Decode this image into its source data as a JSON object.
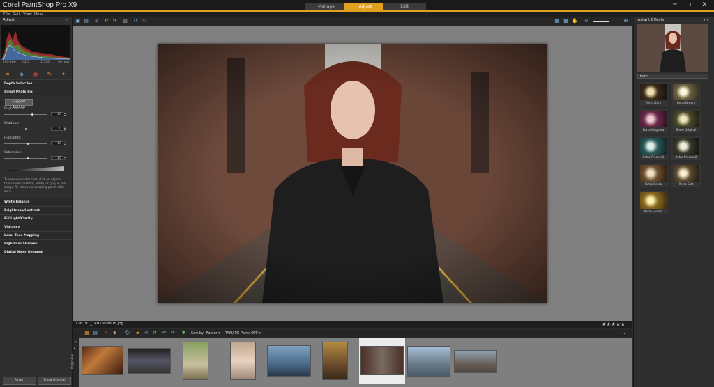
{
  "app": {
    "title": "Corel PaintShop Pro X9"
  },
  "mode_tabs": [
    {
      "label": "Manage"
    },
    {
      "label": "Adjust"
    },
    {
      "label": "Edit"
    }
  ],
  "window_controls": "─ ▫ ✕",
  "menu": [
    {
      "label": "File"
    },
    {
      "label": "Edit"
    },
    {
      "label": "View"
    },
    {
      "label": "Help"
    }
  ],
  "left_panel": {
    "title": "Adjust",
    "exif": {
      "iso": "ISO 200",
      "ev": "f/2.0",
      "shutter": "1/500",
      "focal": "50 mm"
    },
    "depth_selection": "Depth Selection",
    "smart_photo_fix": "Smart Photo Fix",
    "suggest_button": "Suggest Settings",
    "sliders": [
      {
        "label": "Brightness:",
        "value": "20",
        "level": 0.65
      },
      {
        "label": "Shadows:",
        "value": "0",
        "level": 0.5
      },
      {
        "label": "Highlights:",
        "value": "10",
        "level": 0.55
      },
      {
        "label": "Saturation:",
        "value": "10",
        "level": 0.55
      }
    ],
    "help_text": "To remove a color cast, click on objects that should be black, white, or gray in the image. To remove a sampling point, click on it.",
    "sections": [
      {
        "label": "White Balance"
      },
      {
        "label": "Brightness/Contrast"
      },
      {
        "label": "Fill Light/Clarity"
      },
      {
        "label": "Vibrancy"
      },
      {
        "label": "Local Tone Mapping"
      },
      {
        "label": "High Pass Sharpen"
      },
      {
        "label": "Digital Noise Removal"
      }
    ],
    "revert_button": "Revert",
    "show_original_button": "Show Original"
  },
  "image_info": {
    "filename": "136791_1401668806.jpg",
    "rating": "★★★★★"
  },
  "organizer": {
    "label": "Organizer",
    "sort_label": "Sort by:",
    "sort_value": "Folder ▾",
    "raw_pairs": "RAW/JPG Pairs: OFF ▾"
  },
  "right_panel": {
    "title": "Instant Effects",
    "category": "Retro",
    "effects": [
      {
        "label": "Retro Dark"
      },
      {
        "label": "Retro Dream"
      },
      {
        "label": "Retro Magenta"
      },
      {
        "label": "Retro Original"
      },
      {
        "label": "Retro Process1"
      },
      {
        "label": "Retro Process2"
      },
      {
        "label": "Retro Sepia"
      },
      {
        "label": "Retro Soft"
      },
      {
        "label": "Retro Sunset"
      }
    ]
  },
  "colors": {
    "accent": "#e0a020",
    "panel": "#2e2e2e",
    "workspace": "#808080"
  }
}
